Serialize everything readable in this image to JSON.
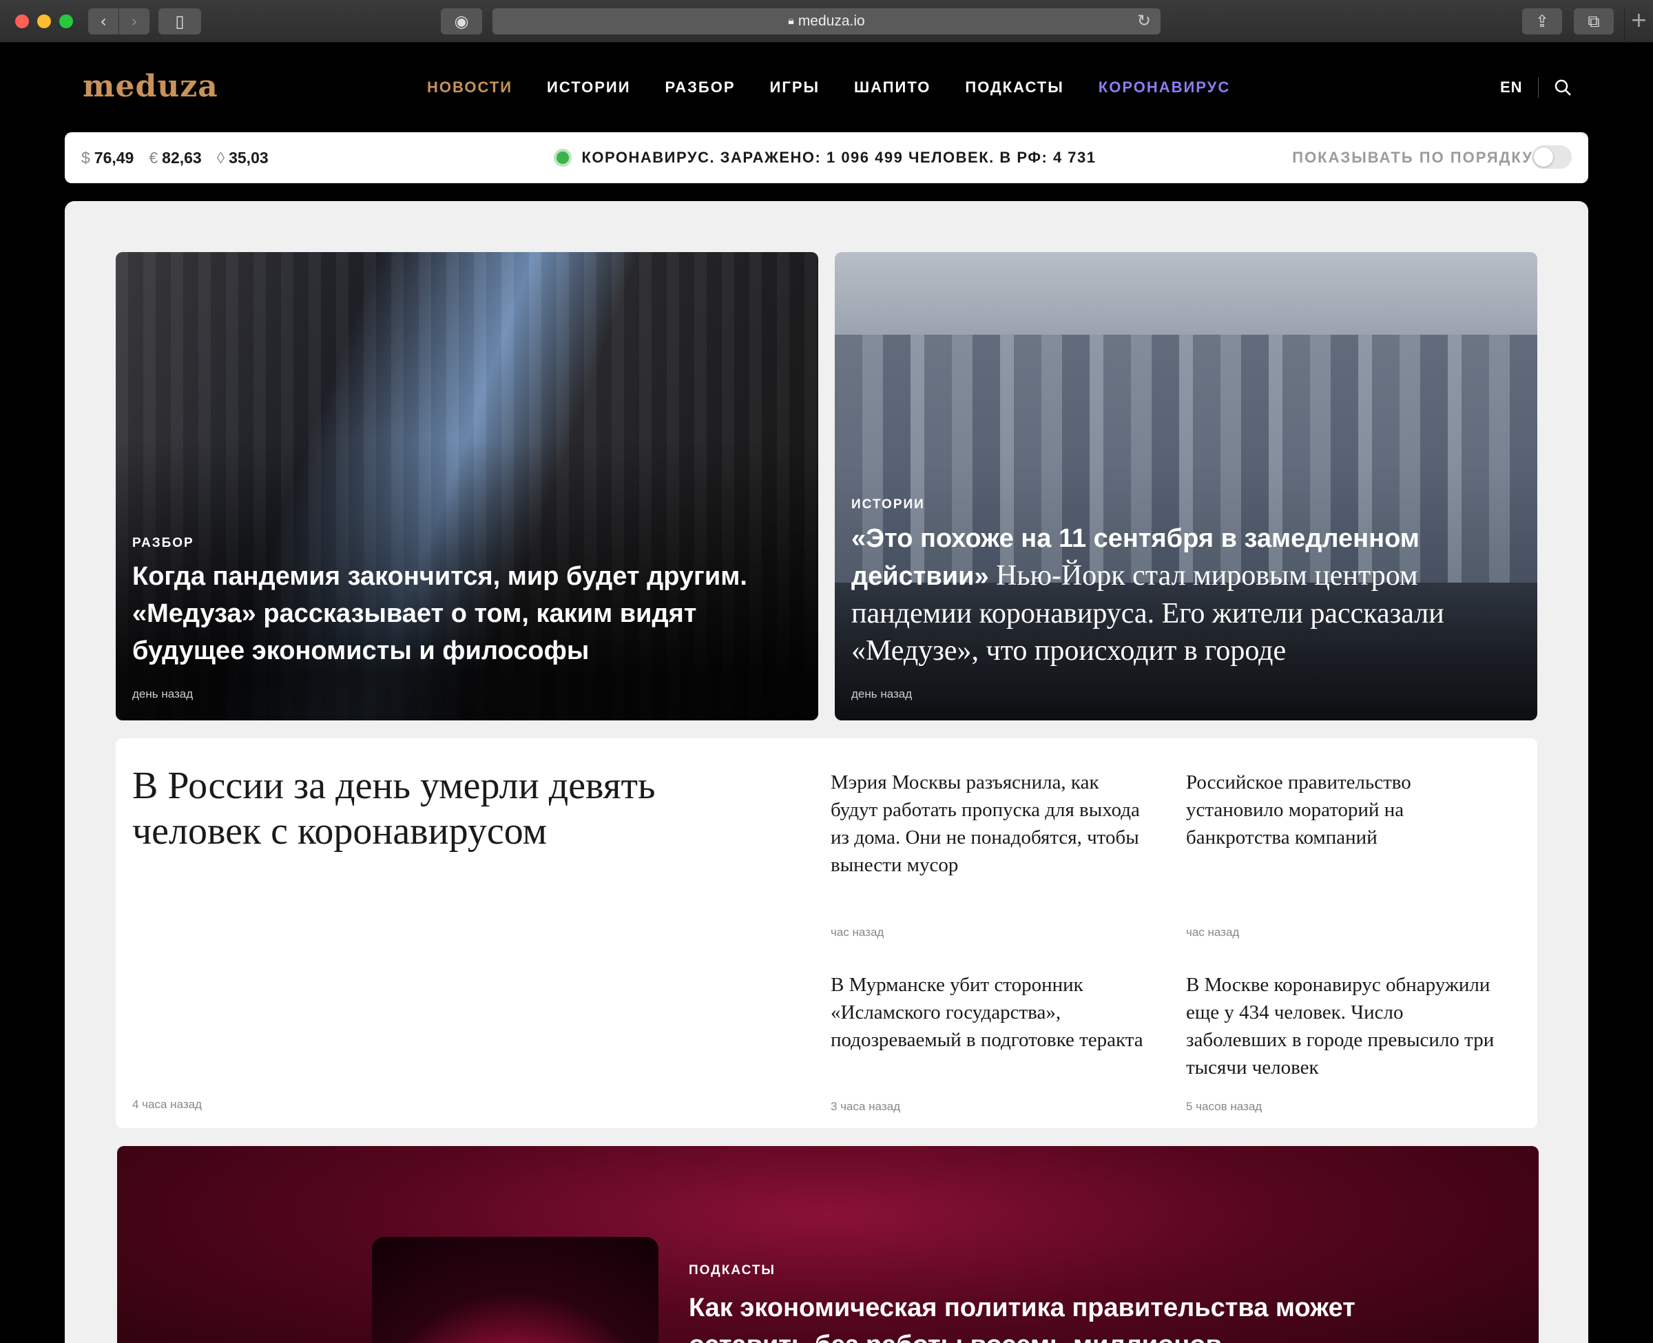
{
  "browser": {
    "url": "meduza.io"
  },
  "header": {
    "logo": "meduza",
    "nav": [
      {
        "label": "НОВОСТИ"
      },
      {
        "label": "ИСТОРИИ"
      },
      {
        "label": "РАЗБОР"
      },
      {
        "label": "ИГРЫ"
      },
      {
        "label": "ШАПИТО"
      },
      {
        "label": "ПОДКАСТЫ"
      },
      {
        "label": "КОРОНАВИРУС"
      }
    ],
    "lang": "EN"
  },
  "infobar": {
    "usd_symbol": "$",
    "usd": "76,49",
    "eur_symbol": "€",
    "eur": "82,63",
    "oil": "35,03",
    "covid": "КОРОНАВИРУС. ЗАРАЖЕНО: 1 096 499 ЧЕЛОВЕК. В РФ: 4 731",
    "order_label": "ПОКАЗЫВАТЬ ПО ПОРЯДКУ"
  },
  "cards": [
    {
      "rubric": "РАЗБОР",
      "title": "Когда пандемия закончится, мир будет другим. «Медуза» рассказывает о том, каким видят будущее экономисты и философы",
      "time": "день назад"
    },
    {
      "rubric": "ИСТОРИИ",
      "title_bold": "«Это похоже на 11 сентября в замедленном действии»",
      "title_rest": " Нью-Йорк стал мировым центром пандемии коронавируса. Его жители рассказали «Медузе», что происходит в городе",
      "time": "день назад"
    }
  ],
  "news": {
    "main": {
      "title": "В России за день умерли девять человек с коронавирусом",
      "time": "4 часа назад"
    },
    "items": [
      {
        "title": "Мэрия Москвы разъяснила, как будут работать пропуска для выхода из дома. Они не понадобятся, чтобы вынести мусор",
        "time": "час назад"
      },
      {
        "title": "Российское правительство установило мораторий на банкротства компаний",
        "time": "час назад"
      },
      {
        "title": "В Мурманске убит сторонник «Исламского государства», подозреваемый в подготовке теракта",
        "time": "3 часа назад"
      },
      {
        "title": "В Москве коронавирус обнаружили еще у 434 человек. Число заболевших в городе превысило три тысячи человек",
        "time": "5 часов назад"
      }
    ]
  },
  "podcast": {
    "rubric": "ПОДКАСТЫ",
    "title": "Как экономическая политика правительства может оставить без работы восемь миллионов"
  }
}
